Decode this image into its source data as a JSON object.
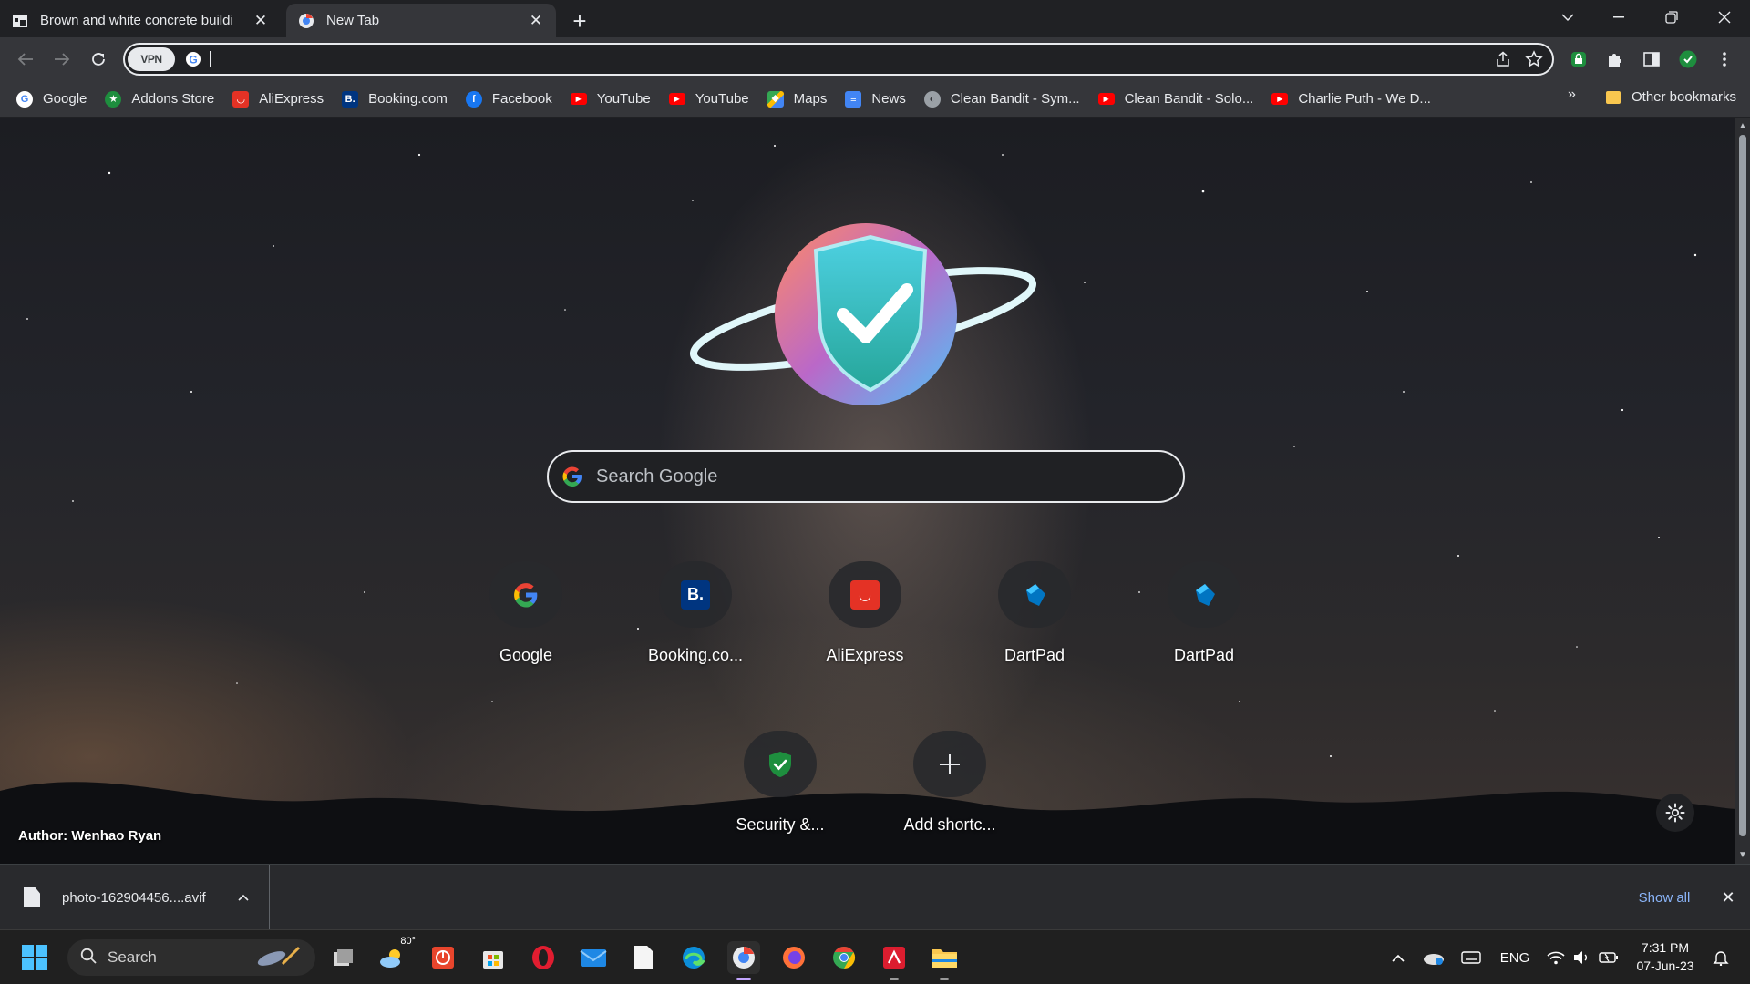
{
  "tabs": [
    {
      "title": "Brown and white concrete buildi",
      "icon": "photo-site-icon",
      "active": false
    },
    {
      "title": "New Tab",
      "icon": "browser-logo-icon",
      "active": true
    }
  ],
  "omnibox": {
    "value": "",
    "vpn_label": "VPN"
  },
  "bookmarks": [
    {
      "label": "Google",
      "icon": "google-icon",
      "color": "#ffffff"
    },
    {
      "label": "Addons Store",
      "icon": "addons-store-icon",
      "color": "#1e8e3e"
    },
    {
      "label": "AliExpress",
      "icon": "aliexpress-icon",
      "color": "#e43225"
    },
    {
      "label": "Booking.com",
      "icon": "booking-icon",
      "color": "#003580"
    },
    {
      "label": "Facebook",
      "icon": "facebook-icon",
      "color": "#1877f2"
    },
    {
      "label": "YouTube",
      "icon": "youtube-icon",
      "color": "#ff0000"
    },
    {
      "label": "YouTube",
      "icon": "youtube-icon",
      "color": "#ff0000"
    },
    {
      "label": "Maps",
      "icon": "maps-icon",
      "color": "#34a853"
    },
    {
      "label": "News",
      "icon": "news-icon",
      "color": "#4285f4"
    },
    {
      "label": "Clean Bandit - Sym...",
      "icon": "globe-icon",
      "color": "#9aa0a6"
    },
    {
      "label": "Clean Bandit - Solo...",
      "icon": "youtube-icon",
      "color": "#ff0000"
    },
    {
      "label": "Charlie Puth - We D...",
      "icon": "youtube-icon",
      "color": "#ff0000"
    }
  ],
  "bookmarks_overflow": "»",
  "other_bookmarks": "Other bookmarks",
  "ntp": {
    "search_placeholder": "Search Google",
    "shortcuts": [
      {
        "label": "Google",
        "icon": "google-icon"
      },
      {
        "label": "Booking.co...",
        "icon": "booking-icon"
      },
      {
        "label": "AliExpress",
        "icon": "aliexpress-icon"
      },
      {
        "label": "DartPad",
        "icon": "dartpad-icon"
      },
      {
        "label": "DartPad",
        "icon": "dartpad-icon"
      },
      {
        "label": "Security &...",
        "icon": "shield-check-icon"
      },
      {
        "label": "Add shortc...",
        "icon": "plus-icon"
      }
    ],
    "author": "Author: Wenhao Ryan"
  },
  "downloads": {
    "file_name": "photo-162904456....avif",
    "show_all": "Show all"
  },
  "taskbar": {
    "search_label": "Search",
    "weather": "80°",
    "language": "ENG",
    "time": "7:31 PM",
    "date": "07-Jun-23"
  },
  "colors": {
    "accent_link": "#8ab4f8",
    "toolbar": "#35363a",
    "frame": "#202124",
    "taskbar": "#202020"
  }
}
